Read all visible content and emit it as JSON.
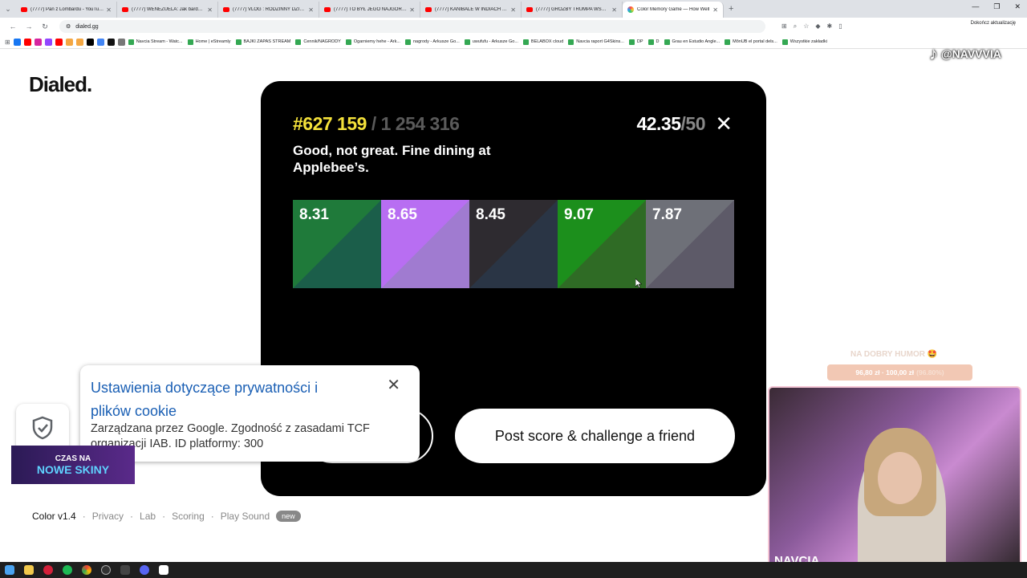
{
  "browser": {
    "tabs": [
      {
        "title": "(7777) Pan z Lombardu - YouTube",
        "icon": "youtube-icon"
      },
      {
        "title": "(7777) WENEZUELA: Jak bardzo je",
        "icon": "youtube-icon"
      },
      {
        "title": "(7777) VLOG : RODZINNY DZIEŃ",
        "icon": "youtube-icon"
      },
      {
        "title": "(7777) TO BYŁ JEGO NAJGORSZY",
        "icon": "youtube-icon"
      },
      {
        "title": "(7777) KANIBALE W INDIACH - D",
        "icon": "youtube-icon"
      },
      {
        "title": "(7777) GROŹBY TRUMPA WSTRZ",
        "icon": "youtube-icon"
      },
      {
        "title": "Color Memory Game — How Well",
        "icon": "color-wheel-icon",
        "active": true
      }
    ],
    "url": "dialed.gg",
    "update_label": "Dokończ aktualizację",
    "bookmarks": [
      "Navcia Stream - Watc...",
      "Home | eStreamly",
      "BAJKI ZAPAS STREAM",
      "Cennik/NAGRODY",
      "Ogarniemy hehe - Ark...",
      "nagrody - Arkusze Go...",
      "uwufufu - Arkusze Go...",
      "BELABOX cloud",
      "Navcia raport G4Skins...",
      "DP",
      "D",
      "Grau en Estudio Angle...",
      "MônUB el portal dels...",
      "Wszystkie zakładki"
    ]
  },
  "page": {
    "logo": "Dialed.",
    "footer": {
      "version": "Color v1.4",
      "links": [
        "Privacy",
        "Lab",
        "Scoring",
        "Play Sound"
      ],
      "badge": "new"
    }
  },
  "modal": {
    "rank": "#627 159",
    "total": "/ 1 254 316",
    "score": "42.35",
    "score_max": "/50",
    "tagline": "Good, not great. Fine dining at Applebee’s.",
    "rounds": [
      {
        "score": "8.31",
        "target": "#1f7a3a",
        "guess": "#1b5e4a"
      },
      {
        "score": "8.65",
        "target": "#b86ef2",
        "guess": "#a07bd0"
      },
      {
        "score": "8.45",
        "target": "#2e2b30",
        "guess": "#2a3545"
      },
      {
        "score": "9.07",
        "target": "#1c8f1c",
        "guess": "#2f6b25"
      },
      {
        "score": "7.87",
        "target": "#6e7078",
        "guess": "#5d5a68"
      }
    ],
    "primary_button": "Post score & challenge a friend",
    "rank_color": "#f4e13a"
  },
  "cookie": {
    "title": "Ustawienia dotyczące prywatności i plików cookie",
    "description": "Zarządzana przez Google. Zgodność z zasadami TCF organizacji IAB. ID platformy: 300"
  },
  "overlays": {
    "tiktok_handle": "@NAVVVIA",
    "goal_title": "NA DOBRY HUMOR 🤩",
    "goal_amount": "96,80 zł · 100,00 zł",
    "goal_percent": "(96.80%)",
    "goal_fraction": 0.968,
    "cam_label": "NAVCIA",
    "promo_line1": "CZAS NA",
    "promo_line2": "NOWE SKINY"
  }
}
